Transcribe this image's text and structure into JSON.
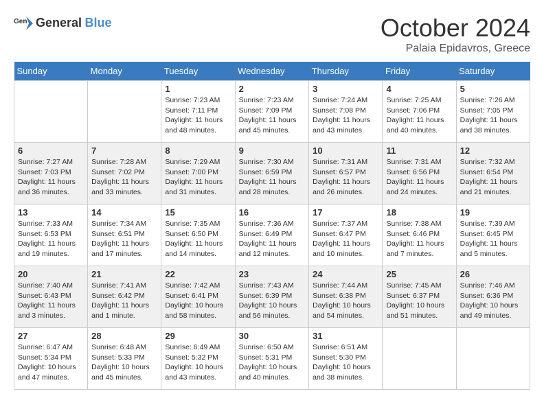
{
  "logo": {
    "general": "General",
    "blue": "Blue"
  },
  "header": {
    "month": "October 2024",
    "location": "Palaia Epidavros, Greece"
  },
  "weekdays": [
    "Sunday",
    "Monday",
    "Tuesday",
    "Wednesday",
    "Thursday",
    "Friday",
    "Saturday"
  ],
  "weeks": [
    [
      {
        "day": "",
        "info": ""
      },
      {
        "day": "",
        "info": ""
      },
      {
        "day": "1",
        "info": "Sunrise: 7:23 AM\nSunset: 7:11 PM\nDaylight: 11 hours and 48 minutes."
      },
      {
        "day": "2",
        "info": "Sunrise: 7:23 AM\nSunset: 7:09 PM\nDaylight: 11 hours and 45 minutes."
      },
      {
        "day": "3",
        "info": "Sunrise: 7:24 AM\nSunset: 7:08 PM\nDaylight: 11 hours and 43 minutes."
      },
      {
        "day": "4",
        "info": "Sunrise: 7:25 AM\nSunset: 7:06 PM\nDaylight: 11 hours and 40 minutes."
      },
      {
        "day": "5",
        "info": "Sunrise: 7:26 AM\nSunset: 7:05 PM\nDaylight: 11 hours and 38 minutes."
      }
    ],
    [
      {
        "day": "6",
        "info": "Sunrise: 7:27 AM\nSunset: 7:03 PM\nDaylight: 11 hours and 36 minutes."
      },
      {
        "day": "7",
        "info": "Sunrise: 7:28 AM\nSunset: 7:02 PM\nDaylight: 11 hours and 33 minutes."
      },
      {
        "day": "8",
        "info": "Sunrise: 7:29 AM\nSunset: 7:00 PM\nDaylight: 11 hours and 31 minutes."
      },
      {
        "day": "9",
        "info": "Sunrise: 7:30 AM\nSunset: 6:59 PM\nDaylight: 11 hours and 28 minutes."
      },
      {
        "day": "10",
        "info": "Sunrise: 7:31 AM\nSunset: 6:57 PM\nDaylight: 11 hours and 26 minutes."
      },
      {
        "day": "11",
        "info": "Sunrise: 7:31 AM\nSunset: 6:56 PM\nDaylight: 11 hours and 24 minutes."
      },
      {
        "day": "12",
        "info": "Sunrise: 7:32 AM\nSunset: 6:54 PM\nDaylight: 11 hours and 21 minutes."
      }
    ],
    [
      {
        "day": "13",
        "info": "Sunrise: 7:33 AM\nSunset: 6:53 PM\nDaylight: 11 hours and 19 minutes."
      },
      {
        "day": "14",
        "info": "Sunrise: 7:34 AM\nSunset: 6:51 PM\nDaylight: 11 hours and 17 minutes."
      },
      {
        "day": "15",
        "info": "Sunrise: 7:35 AM\nSunset: 6:50 PM\nDaylight: 11 hours and 14 minutes."
      },
      {
        "day": "16",
        "info": "Sunrise: 7:36 AM\nSunset: 6:49 PM\nDaylight: 11 hours and 12 minutes."
      },
      {
        "day": "17",
        "info": "Sunrise: 7:37 AM\nSunset: 6:47 PM\nDaylight: 11 hours and 10 minutes."
      },
      {
        "day": "18",
        "info": "Sunrise: 7:38 AM\nSunset: 6:46 PM\nDaylight: 11 hours and 7 minutes."
      },
      {
        "day": "19",
        "info": "Sunrise: 7:39 AM\nSunset: 6:45 PM\nDaylight: 11 hours and 5 minutes."
      }
    ],
    [
      {
        "day": "20",
        "info": "Sunrise: 7:40 AM\nSunset: 6:43 PM\nDaylight: 11 hours and 3 minutes."
      },
      {
        "day": "21",
        "info": "Sunrise: 7:41 AM\nSunset: 6:42 PM\nDaylight: 11 hours and 1 minute."
      },
      {
        "day": "22",
        "info": "Sunrise: 7:42 AM\nSunset: 6:41 PM\nDaylight: 10 hours and 58 minutes."
      },
      {
        "day": "23",
        "info": "Sunrise: 7:43 AM\nSunset: 6:39 PM\nDaylight: 10 hours and 56 minutes."
      },
      {
        "day": "24",
        "info": "Sunrise: 7:44 AM\nSunset: 6:38 PM\nDaylight: 10 hours and 54 minutes."
      },
      {
        "day": "25",
        "info": "Sunrise: 7:45 AM\nSunset: 6:37 PM\nDaylight: 10 hours and 51 minutes."
      },
      {
        "day": "26",
        "info": "Sunrise: 7:46 AM\nSunset: 6:36 PM\nDaylight: 10 hours and 49 minutes."
      }
    ],
    [
      {
        "day": "27",
        "info": "Sunrise: 6:47 AM\nSunset: 5:34 PM\nDaylight: 10 hours and 47 minutes."
      },
      {
        "day": "28",
        "info": "Sunrise: 6:48 AM\nSunset: 5:33 PM\nDaylight: 10 hours and 45 minutes."
      },
      {
        "day": "29",
        "info": "Sunrise: 6:49 AM\nSunset: 5:32 PM\nDaylight: 10 hours and 43 minutes."
      },
      {
        "day": "30",
        "info": "Sunrise: 6:50 AM\nSunset: 5:31 PM\nDaylight: 10 hours and 40 minutes."
      },
      {
        "day": "31",
        "info": "Sunrise: 6:51 AM\nSunset: 5:30 PM\nDaylight: 10 hours and 38 minutes."
      },
      {
        "day": "",
        "info": ""
      },
      {
        "day": "",
        "info": ""
      }
    ]
  ]
}
